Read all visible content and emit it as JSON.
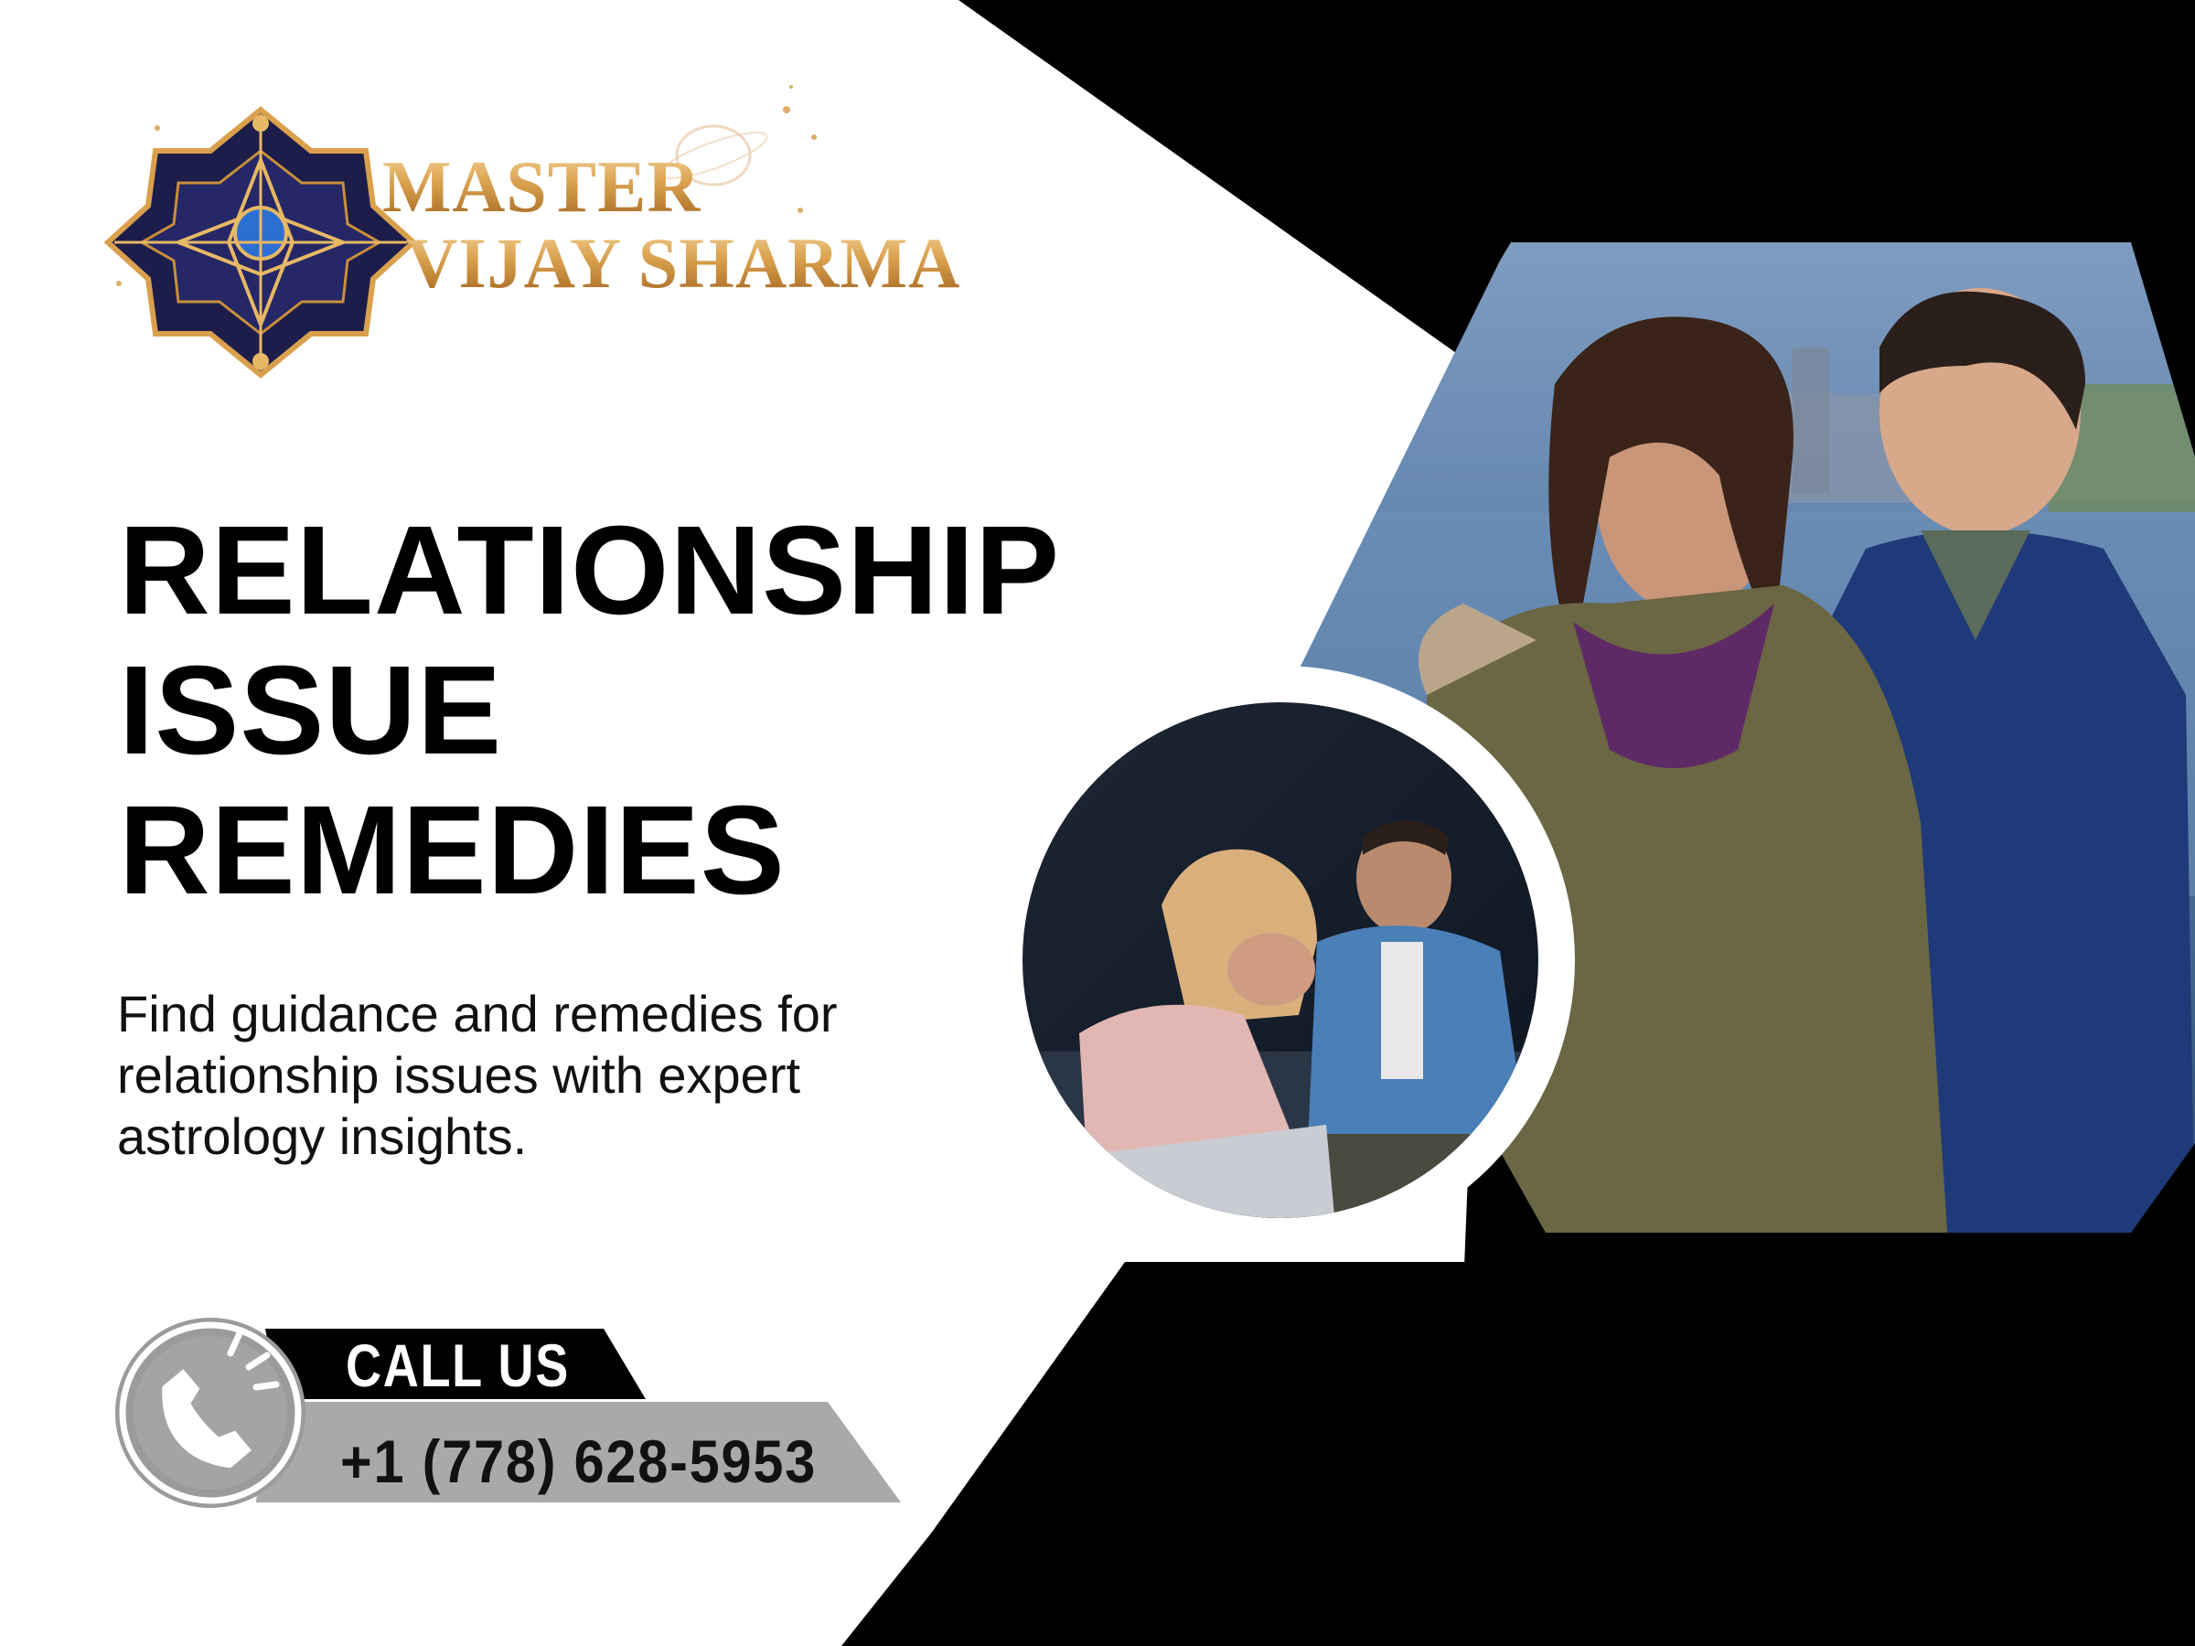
{
  "brand": {
    "line1": "MASTER",
    "line2": "VIJAY SHARMA",
    "gold": "#d9a04d",
    "navy": "#1c1d4a"
  },
  "headline": {
    "lines": [
      "RELATIONSHIP",
      "ISSUE",
      "REMEDIES"
    ]
  },
  "subtext": {
    "lines": [
      "Find guidance and remedies for",
      "relationship issues with expert",
      "astrology insights."
    ]
  },
  "cta": {
    "label": "CALL US",
    "phone": "+1 (778) 628-5953",
    "icon": "phone-icon"
  },
  "photos": {
    "main": "couple-embrace-photo",
    "inset": "upset-couple-photo"
  },
  "colors": {
    "background": "#ffffff",
    "dark_panel": "#000000",
    "gray_band": "#a8a8a8",
    "circle_gray": "#9e9e9e"
  }
}
